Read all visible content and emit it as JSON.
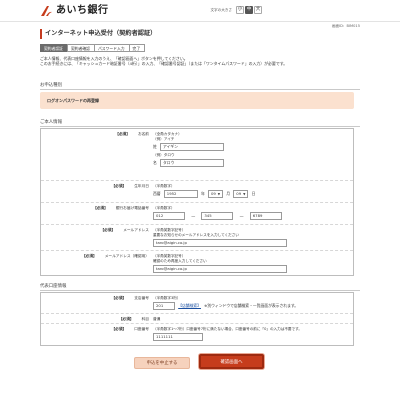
{
  "header": {
    "bank_name": "あいち銀行",
    "fontsize_label": "文字の大きさ",
    "fontsize_options": [
      "小",
      "中",
      "大"
    ],
    "fontsize_selected": "中"
  },
  "screen_id": "画面ID：BIM015",
  "page_title": "インターネット申込受付（契約者認証）",
  "steps": [
    "契約者認証",
    "契約者確認",
    "パスワード入力",
    "完了"
  ],
  "intro": [
    "ご本人情報、代表口座情報を入力のうえ、「確認画面へ」ボタンを押してください。",
    "このお手続きには、「キャッシュカード暗証番号（4桁）」の入力、「確認番号認証」（または「ワンタイムパスワード」の入力）が必要です。"
  ],
  "applicant_type": {
    "heading": "お申込種別",
    "value": "ログオンパスワードの再登録"
  },
  "personal": {
    "heading": "ご本人情報",
    "required_label": "【必須】",
    "name": {
      "label": "お名前",
      "hint_kana": "（全角カタカナ）",
      "hint_sei": "（例）アイチ",
      "sei_prefix": "姓",
      "sei_value": "アイギン",
      "hint_mei": "（例）タロウ",
      "mei_prefix": "名",
      "mei_value": "タロウ"
    },
    "birthday": {
      "label": "生年月日",
      "hint": "（半角数字）",
      "era": "西暦",
      "year": "1952",
      "year_unit": "年",
      "month": "09",
      "month_unit": "月",
      "day": "09",
      "day_unit": "日"
    },
    "phone": {
      "label": "銀行お届け電話番号",
      "hint": "（半角数字）",
      "part1": "012",
      "part2": "345",
      "part3": "6789"
    },
    "email": {
      "label": "メールアドレス",
      "hint1": "（半角英数字記号）",
      "hint2": "重要なお知らせのメールアドレスを入力してください",
      "value": "taro@aigin.co.jp"
    },
    "email_confirm": {
      "label": "メールアドレス（確認用）",
      "hint1": "（半角英数字記号）",
      "hint2": "確認のため再度入力してください",
      "value": "taro@aigin.co.jp"
    }
  },
  "account": {
    "heading": "代表口座情報",
    "required_label": "【必須】",
    "branch": {
      "label": "支店番号",
      "hint": "（半角数字3桁）",
      "value": "201",
      "link_text": "【店舗検索】",
      "note": "※別ウィンドウで店舗検索・一覧画面が表示されます。"
    },
    "type": {
      "label": "科目",
      "value": "普通"
    },
    "number": {
      "label": "口座番号",
      "hint": "（半角数字1〜7桁）口座番号7桁に満たない場合、口座番号の前に「0」の入力は不要です。",
      "value": "1111111"
    }
  },
  "buttons": {
    "cancel": "申込を中止する",
    "next": "確認画面へ"
  },
  "colors": {
    "brand_red": "#c63c1c",
    "notice_bg": "#fbe1cf",
    "cancel_bg": "#f6d2bd"
  }
}
